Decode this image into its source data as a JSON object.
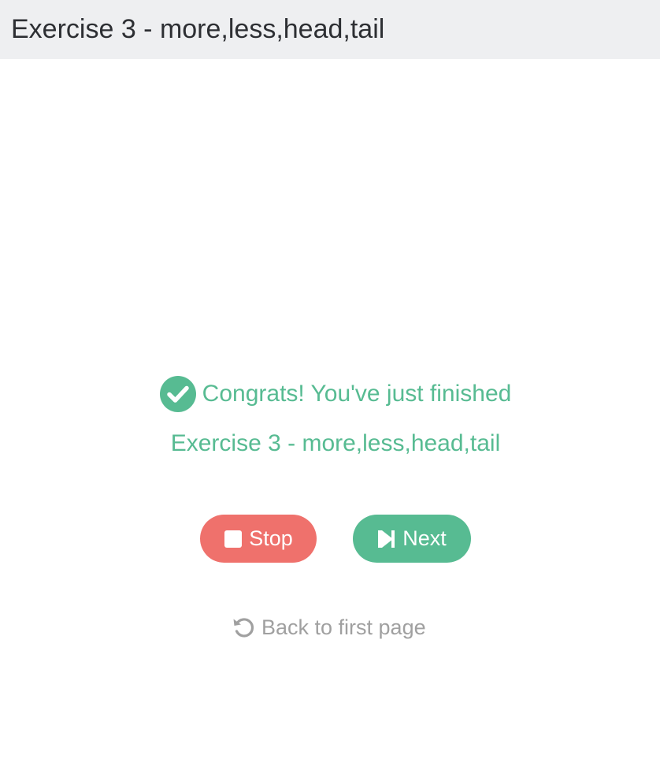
{
  "header": {
    "title": "Exercise 3 - more,less,head,tail"
  },
  "result": {
    "message": "Congrats! You've just finished",
    "exercise_name": "Exercise 3 - more,less,head,tail",
    "icon": "check-circle-icon"
  },
  "actions": {
    "stop_label": "Stop",
    "stop_icon": "stop-icon",
    "next_label": "Next",
    "next_icon": "step-forward-icon",
    "back_label": "Back to first page",
    "back_icon": "undo-icon"
  },
  "colors": {
    "success": "#57bb92",
    "danger": "#ef716c",
    "muted": "#a0a0a0",
    "header_bg": "#eeeff1"
  }
}
